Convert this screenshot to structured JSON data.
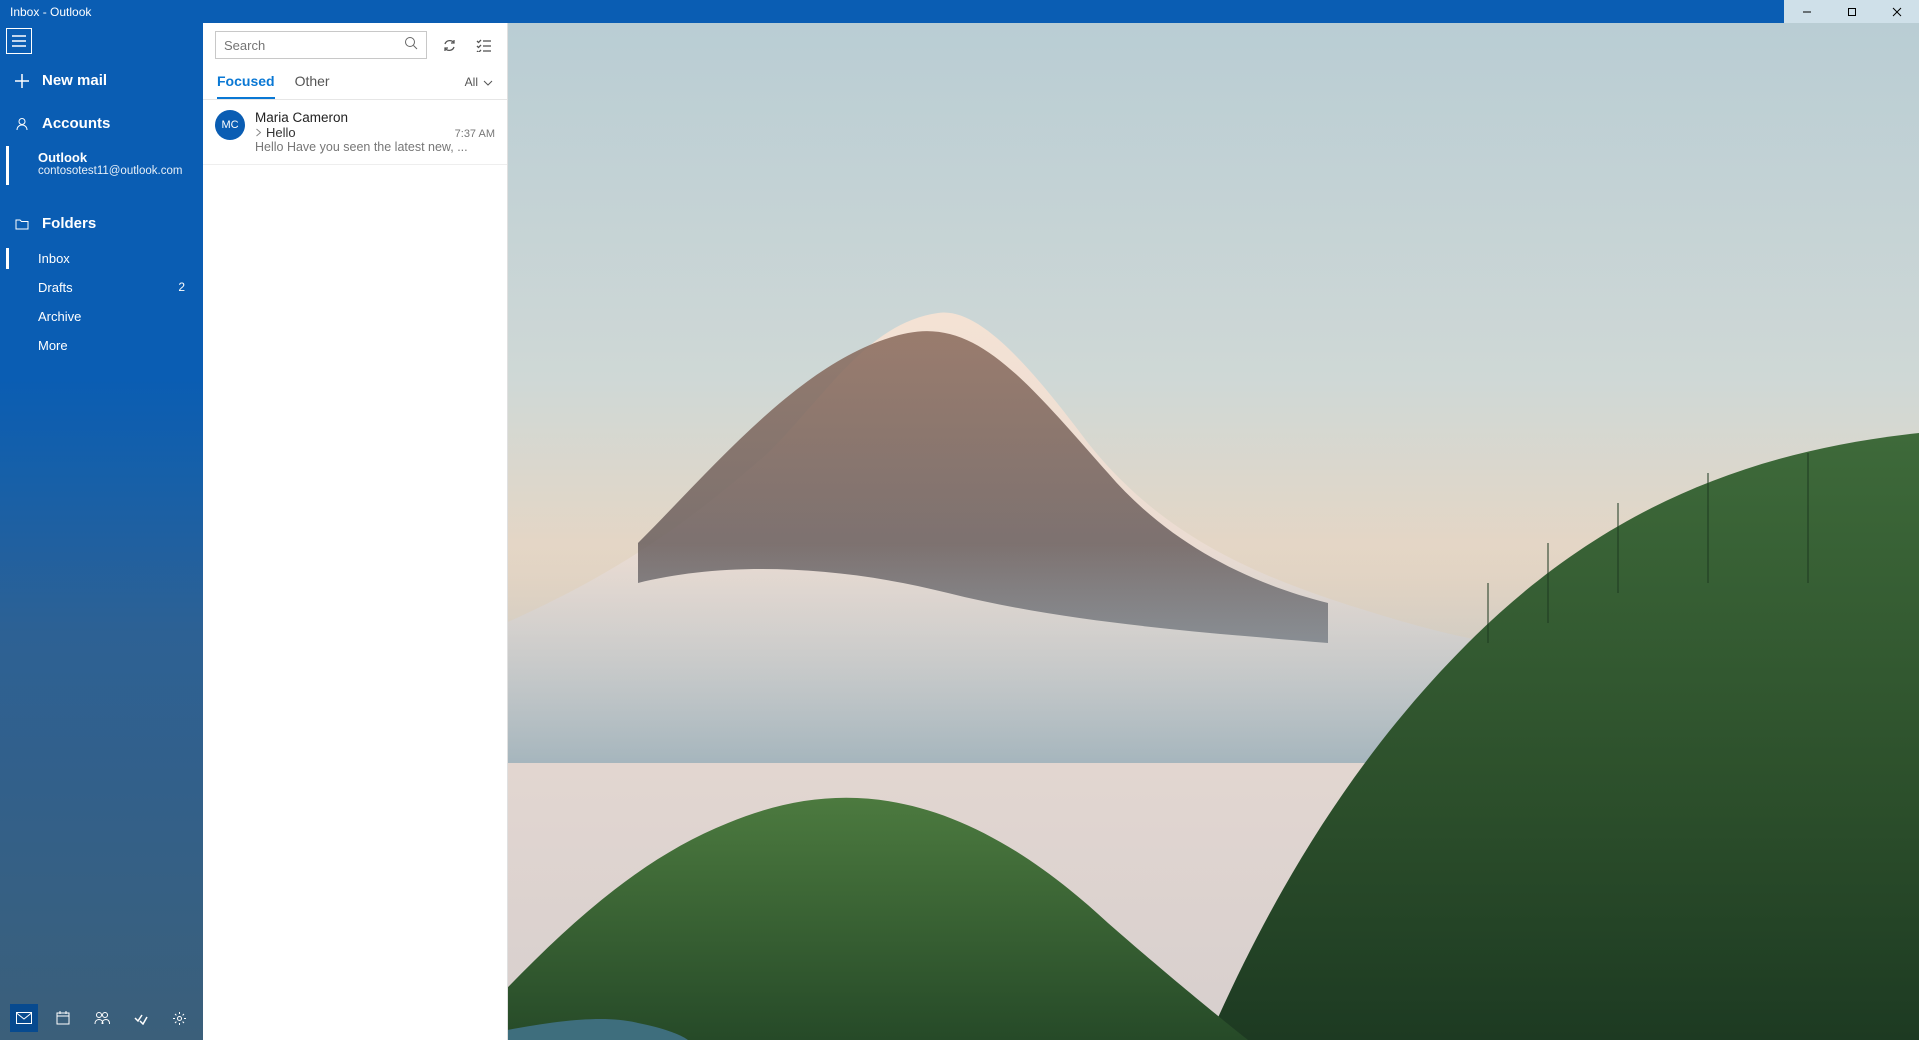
{
  "window": {
    "title": "Inbox - Outlook"
  },
  "sidebar": {
    "new_mail_label": "New mail",
    "accounts_label": "Accounts",
    "account": {
      "name": "Outlook",
      "address": "contosotest11@outlook.com"
    },
    "folders_label": "Folders",
    "folders": [
      {
        "label": "Inbox",
        "count": "",
        "selected": true
      },
      {
        "label": "Drafts",
        "count": "2",
        "selected": false
      },
      {
        "label": "Archive",
        "count": "",
        "selected": false
      },
      {
        "label": "More",
        "count": "",
        "selected": false
      }
    ],
    "bottom_icons": [
      "mail-icon",
      "calendar-icon",
      "people-icon",
      "todo-icon",
      "settings-icon"
    ]
  },
  "list": {
    "search_placeholder": "Search",
    "tabs": {
      "focused": "Focused",
      "other": "Other"
    },
    "filter_label": "All",
    "messages": [
      {
        "initials": "MC",
        "sender": "Maria Cameron",
        "subject": "Hello",
        "time": "7:37 AM",
        "preview": "Hello Have you seen the latest new, ..."
      }
    ]
  },
  "colors": {
    "accent": "#0a5db3",
    "tab_accent": "#0a78d4"
  }
}
